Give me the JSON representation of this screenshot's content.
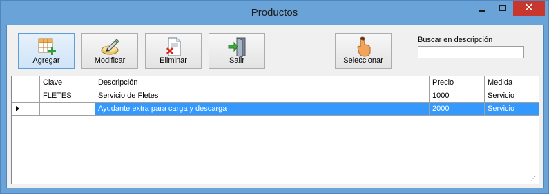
{
  "window": {
    "title": "Productos",
    "minimize_glyph": "",
    "maximize_glyph": "",
    "close_glyph": "✕"
  },
  "toolbar": {
    "agregar": "Agregar",
    "modificar": "Modificar",
    "eliminar": "Eliminar",
    "salir": "Salir",
    "seleccionar": "Seleccionar"
  },
  "search": {
    "label": "Buscar en descripción",
    "value": ""
  },
  "table": {
    "headers": [
      "",
      "Clave",
      "Descripción",
      "Precio",
      "Medida"
    ],
    "rows": [
      {
        "clave": "FLETES",
        "descripcion": "Servicio de Fletes",
        "precio": "1000",
        "medida": "Servicio",
        "selected": false
      },
      {
        "clave": "",
        "descripcion": "Ayudante extra para carga y descarga",
        "precio": "2000",
        "medida": "Servicio",
        "selected": true
      }
    ]
  },
  "colors": {
    "title_bg": "#6aa3d8",
    "close_bg": "#c7372d",
    "selection": "#3399ff"
  },
  "icons": [
    "grid-add-icon",
    "edit-pencil-icon",
    "delete-document-icon",
    "exit-door-icon",
    "pointer-hand-icon",
    "row-indicator-icon",
    "resize-grip-icon"
  ]
}
